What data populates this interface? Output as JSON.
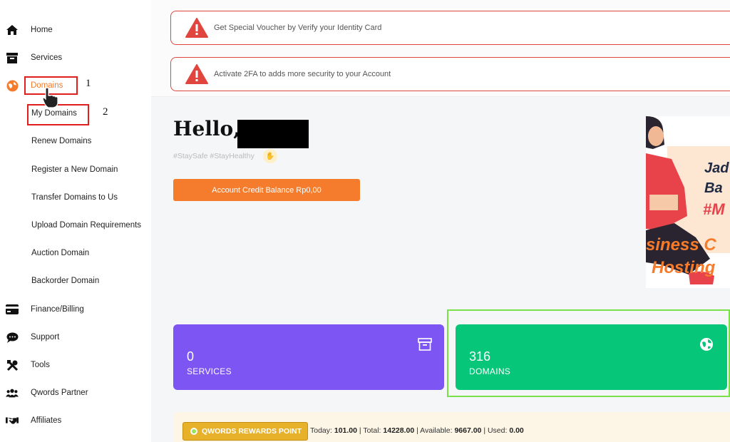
{
  "sidebar": {
    "items": [
      {
        "label": "Home",
        "icon": "home-icon"
      },
      {
        "label": "Services",
        "icon": "archive-icon"
      },
      {
        "label": "Domains",
        "icon": "globe-icon",
        "active": true
      },
      {
        "label": "My Domains"
      },
      {
        "label": "Renew Domains"
      },
      {
        "label": "Register a New Domain"
      },
      {
        "label": "Transfer Domains to Us"
      },
      {
        "label": "Upload Domain Requirements"
      },
      {
        "label": "Auction Domain"
      },
      {
        "label": "Backorder Domain"
      },
      {
        "label": "Finance/Billing",
        "icon": "credit-card-icon"
      },
      {
        "label": "Support",
        "icon": "chat-icon"
      },
      {
        "label": "Tools",
        "icon": "tools-icon"
      },
      {
        "label": "Qwords Partner",
        "icon": "users-icon"
      },
      {
        "label": "Affiliates",
        "icon": "handshake-icon"
      }
    ]
  },
  "annotations": {
    "step1": "1",
    "step2": "2"
  },
  "alerts": [
    {
      "text": "Get Special Voucher by Verify your Identity Card"
    },
    {
      "text": "Activate 2FA to adds more security to your Account"
    }
  ],
  "greeting": {
    "hello": "Hello,",
    "tags": "#StaySafe #StayHealthy"
  },
  "credit_button": "Account Credit Balance Rp0,00",
  "banner": {
    "line1": "Jad",
    "line2": "Ba",
    "line3": "#M",
    "line4": "siness C",
    "line5": "Hosting"
  },
  "cards": {
    "services": {
      "count": "0",
      "label": "SERVICES"
    },
    "domains": {
      "count": "316",
      "label": "DOMAINS"
    }
  },
  "rewards": {
    "button": "QWORDS REWARDS POINT",
    "today_label": "Today:",
    "today": "101.00",
    "total_label": "Total:",
    "total": "14228.00",
    "available_label": "Available:",
    "available": "9667.00",
    "used_label": "Used:",
    "used": "0.00"
  },
  "colors": {
    "accent": "#f47c2c",
    "services_card": "#7c55f3",
    "domains_card": "#06c67a",
    "alert_border": "#e0463d"
  }
}
